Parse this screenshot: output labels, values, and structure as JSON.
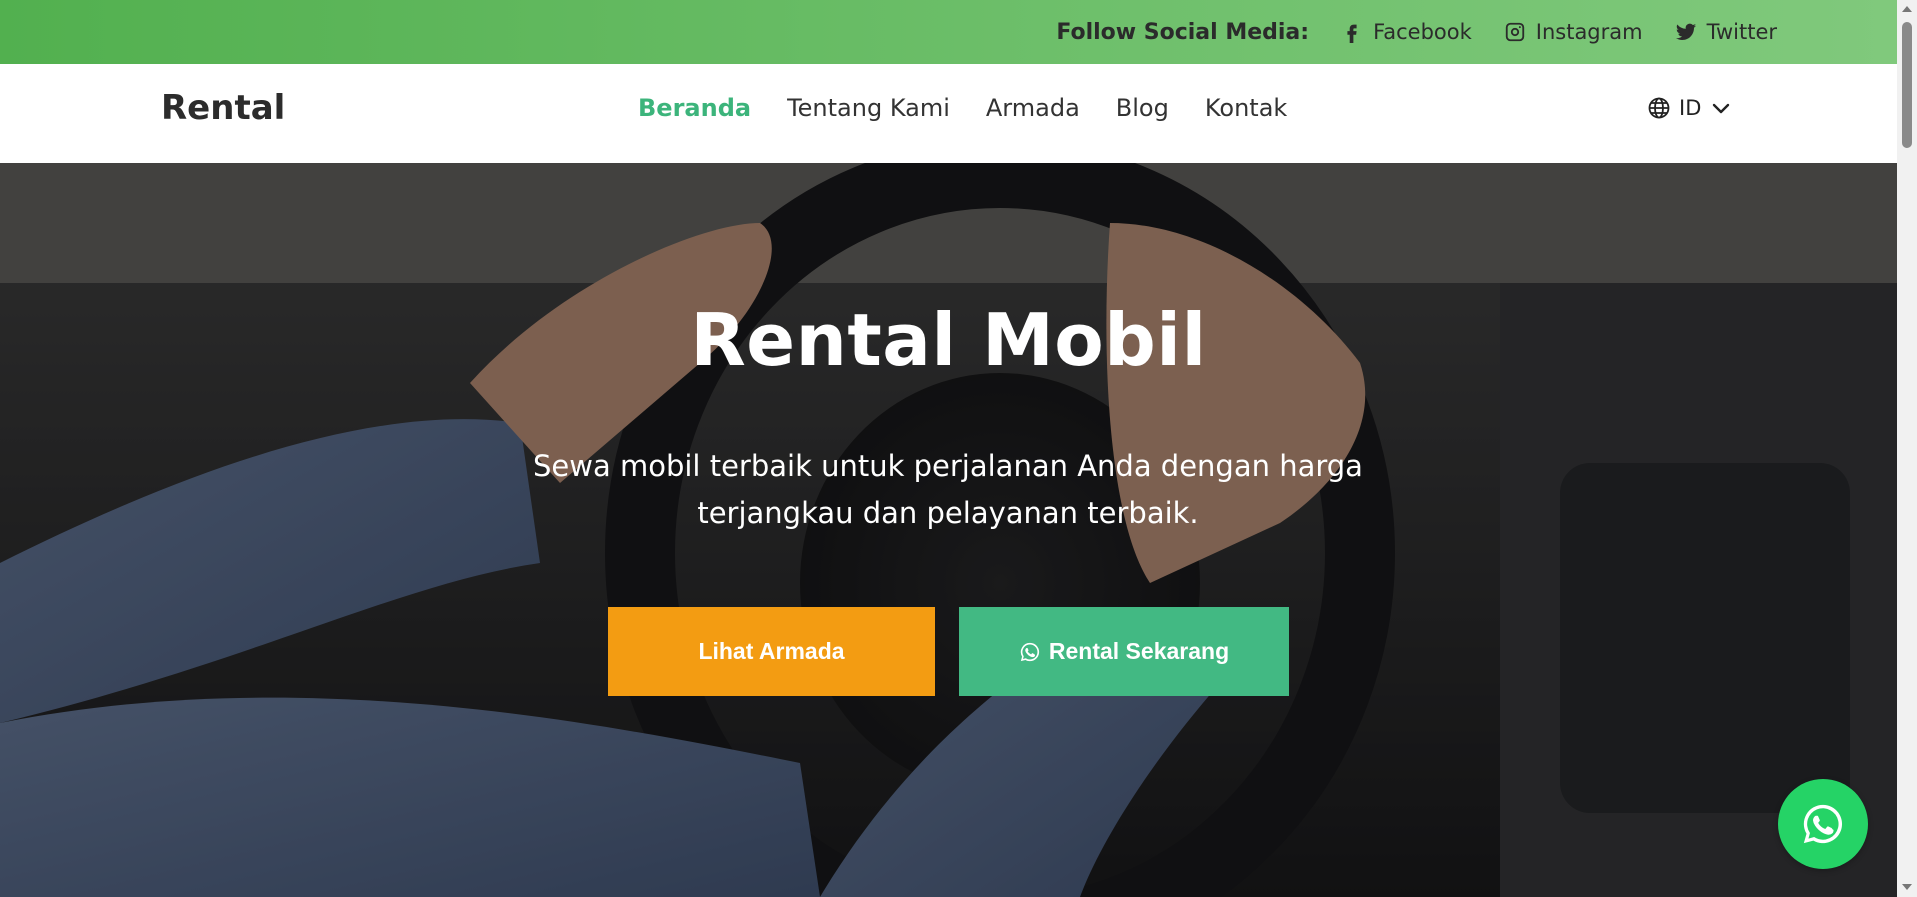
{
  "topbar": {
    "follow_label": "Follow Social Media:",
    "links": [
      {
        "label": "Facebook",
        "icon": "facebook-icon"
      },
      {
        "label": "Instagram",
        "icon": "instagram-icon"
      },
      {
        "label": "Twitter",
        "icon": "twitter-icon"
      }
    ]
  },
  "navbar": {
    "brand": "Rental",
    "links": [
      {
        "label": "Beranda",
        "active": true
      },
      {
        "label": "Tentang Kami",
        "active": false
      },
      {
        "label": "Armada",
        "active": false
      },
      {
        "label": "Blog",
        "active": false
      },
      {
        "label": "Kontak",
        "active": false
      }
    ],
    "language": {
      "value": "ID",
      "icon": "globe-icon",
      "chevron": "chevron-down-icon"
    }
  },
  "hero": {
    "title": "Rental Mobil",
    "subtitle": "Sewa mobil terbaik untuk perjalanan Anda dengan harga terjangkau dan pelayanan terbaik.",
    "buttons": {
      "primary_label": "Lihat Armada",
      "secondary_label": "Rental Sekarang",
      "secondary_icon": "whatsapp-icon"
    },
    "floating_button_icon": "whatsapp-icon"
  },
  "colors": {
    "topbar_green": "#5cb85c",
    "accent_green": "#42b983",
    "active_nav": "#3cb47b",
    "orange": "#f39c12",
    "whatsapp": "#25d366"
  }
}
